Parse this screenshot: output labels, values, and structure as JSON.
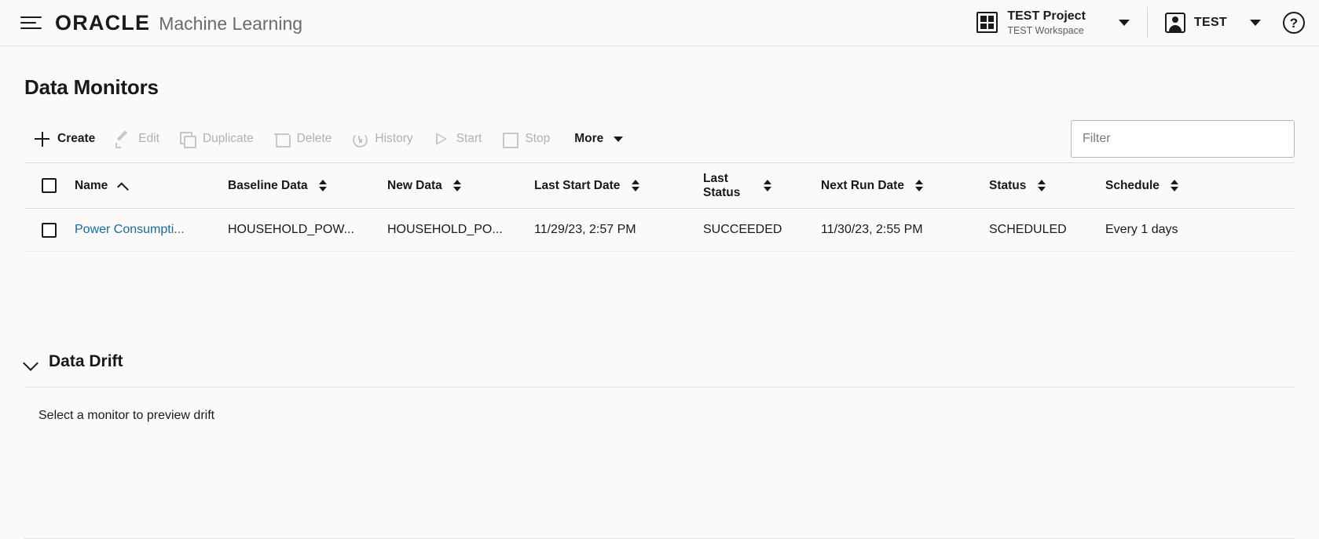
{
  "header": {
    "menu_icon": "hamburger-icon",
    "brand_primary": "ORACLE",
    "brand_secondary": "Machine Learning",
    "project": {
      "icon": "grid-icon",
      "name": "TEST Project",
      "workspace": "TEST Workspace",
      "caret": "chevron-down-icon"
    },
    "user": {
      "icon": "person-icon",
      "name": "TEST",
      "caret": "chevron-down-icon"
    },
    "help_label": "?"
  },
  "page": {
    "title": "Data Monitors"
  },
  "toolbar": {
    "buttons": [
      {
        "label": "Create",
        "icon": "plus-icon",
        "enabled": true
      },
      {
        "label": "Edit",
        "icon": "pencil-icon",
        "enabled": false
      },
      {
        "label": "Duplicate",
        "icon": "copy-icon",
        "enabled": false
      },
      {
        "label": "Delete",
        "icon": "trash-icon",
        "enabled": false
      },
      {
        "label": "History",
        "icon": "history-icon",
        "enabled": false
      },
      {
        "label": "Start",
        "icon": "play-icon",
        "enabled": false
      },
      {
        "label": "Stop",
        "icon": "stop-icon",
        "enabled": false
      }
    ],
    "more_label": "More",
    "filter": {
      "value": "",
      "placeholder": "Filter"
    }
  },
  "table": {
    "select_all_checked": false,
    "columns": [
      {
        "label": "Name",
        "sort": "asc"
      },
      {
        "label": "Baseline Data",
        "sort": "none"
      },
      {
        "label": "New Data",
        "sort": "none"
      },
      {
        "label": "Last Start Date",
        "sort": "none"
      },
      {
        "label": "Last Status",
        "sort": "none"
      },
      {
        "label": "Next Run Date",
        "sort": "none"
      },
      {
        "label": "Status",
        "sort": "none"
      },
      {
        "label": "Schedule",
        "sort": "none"
      }
    ],
    "rows": [
      {
        "checked": false,
        "name": "Power Consumpti...",
        "baseline_data": "HOUSEHOLD_POW...",
        "new_data": "HOUSEHOLD_PO...",
        "last_start_date": "11/29/23, 2:57 PM",
        "last_status": "SUCCEEDED",
        "next_run_date": "11/30/23, 2:55 PM",
        "status": "SCHEDULED",
        "schedule": "Every 1 days"
      }
    ]
  },
  "data_drift": {
    "title": "Data Drift",
    "expanded": true,
    "empty_message": "Select a monitor to preview drift"
  },
  "colors": {
    "link": "#126ca0",
    "background": "#fbfaf9",
    "text": "#1a1a1a",
    "disabled": "#b3b0ad",
    "border": "#e3e1df"
  }
}
